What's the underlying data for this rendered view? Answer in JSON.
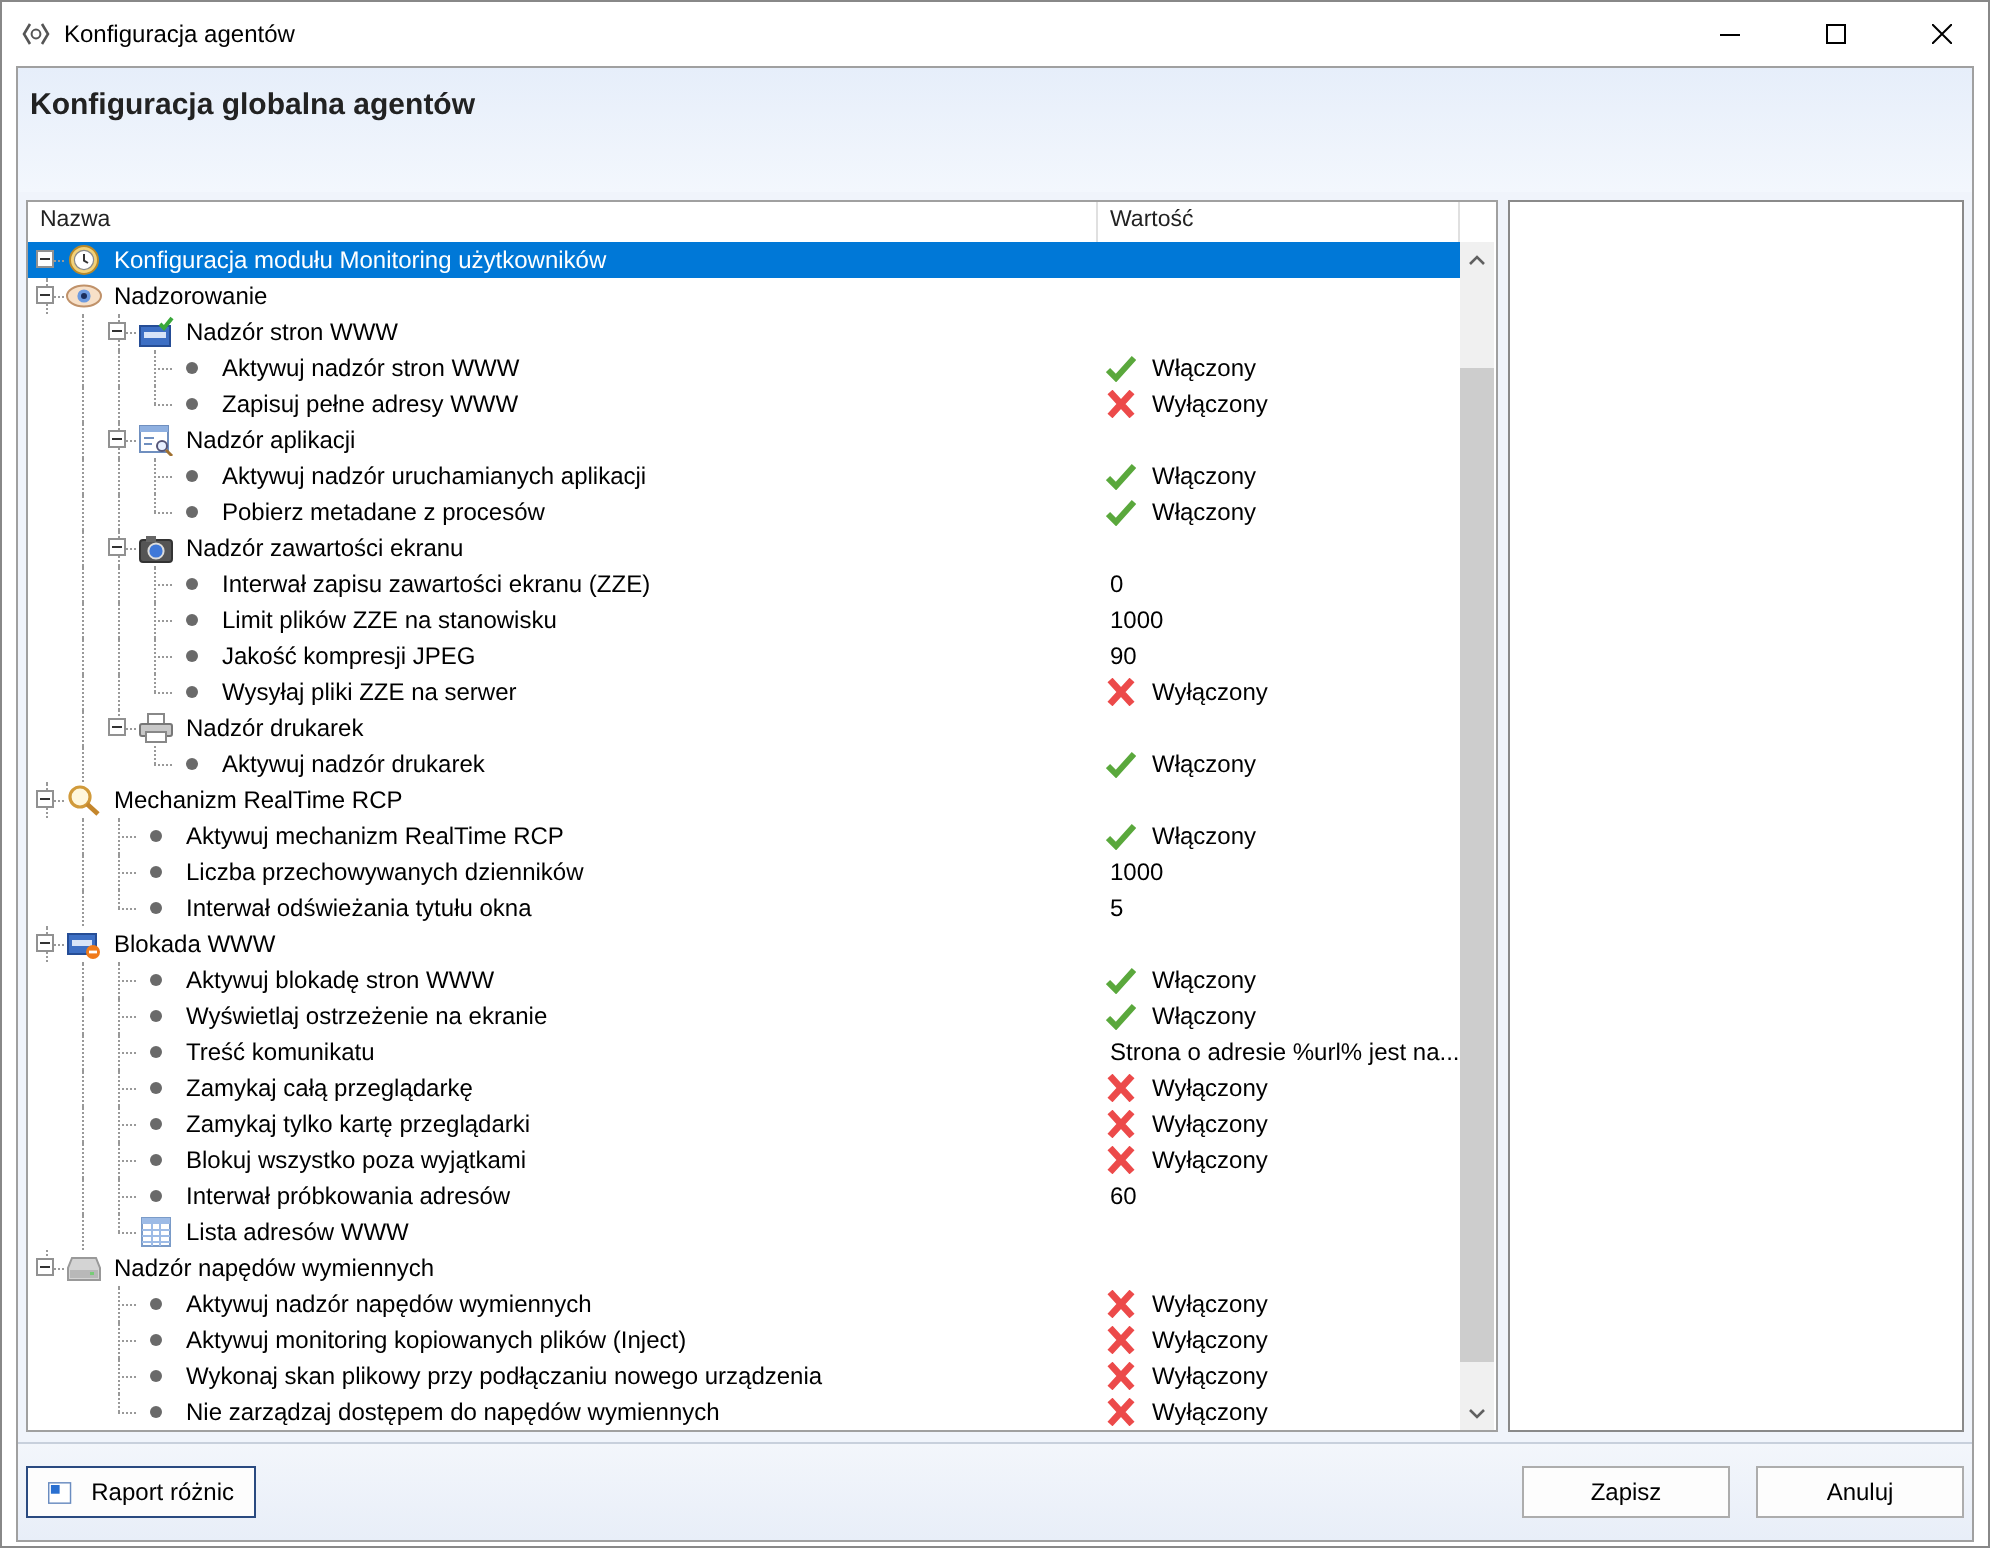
{
  "window": {
    "title": "Konfiguracja agentów"
  },
  "header": {
    "title": "Konfiguracja globalna agentów"
  },
  "tree": {
    "columns": [
      "Nazwa",
      "Wartość"
    ],
    "nodes": [
      {
        "label": "Konfiguracja modułu Monitoring użytkowników",
        "kind": "group",
        "expanded": true,
        "selected": true,
        "children": [
          {
            "label": "Nadzorowanie",
            "kind": "group",
            "expanded": true,
            "selected": false,
            "children": [
              {
                "label": "Nadzór stron WWW",
                "kind": "group",
                "expanded": true,
                "selected": false,
                "children": [
                  {
                    "label": "Aktywuj nadzór stron WWW",
                    "kind": "setting",
                    "selected": false,
                    "value": {
                      "kind": "toggle",
                      "on": true,
                      "text": "Włączony"
                    }
                  },
                  {
                    "label": "Zapisuj pełne adresy WWW",
                    "kind": "setting",
                    "selected": false,
                    "value": {
                      "kind": "toggle",
                      "on": false,
                      "text": "Wyłączony"
                    }
                  }
                ]
              },
              {
                "label": "Nadzór aplikacji",
                "kind": "group",
                "expanded": true,
                "selected": false,
                "children": [
                  {
                    "label": "Aktywuj nadzór uruchamianych aplikacji",
                    "kind": "setting",
                    "selected": false,
                    "value": {
                      "kind": "toggle",
                      "on": true,
                      "text": "Włączony"
                    }
                  },
                  {
                    "label": "Pobierz metadane z procesów",
                    "kind": "setting",
                    "selected": false,
                    "value": {
                      "kind": "toggle",
                      "on": true,
                      "text": "Włączony"
                    }
                  }
                ]
              },
              {
                "label": "Nadzór zawartości ekranu",
                "kind": "group",
                "expanded": true,
                "selected": false,
                "children": [
                  {
                    "label": "Interwał zapisu zawartości ekranu (ZZE)",
                    "kind": "setting",
                    "selected": false,
                    "value": {
                      "kind": "text",
                      "text": "0"
                    }
                  },
                  {
                    "label": "Limit plików ZZE na stanowisku",
                    "kind": "setting",
                    "selected": false,
                    "value": {
                      "kind": "text",
                      "text": "1000"
                    }
                  },
                  {
                    "label": "Jakość kompresji JPEG",
                    "kind": "setting",
                    "selected": false,
                    "value": {
                      "kind": "text",
                      "text": "90"
                    }
                  },
                  {
                    "label": "Wysyłaj pliki ZZE na serwer",
                    "kind": "setting",
                    "selected": false,
                    "value": {
                      "kind": "toggle",
                      "on": false,
                      "text": "Wyłączony"
                    }
                  }
                ]
              },
              {
                "label": "Nadzór drukarek",
                "kind": "group",
                "expanded": true,
                "selected": false,
                "children": [
                  {
                    "label": "Aktywuj nadzór drukarek",
                    "kind": "setting",
                    "selected": false,
                    "value": {
                      "kind": "toggle",
                      "on": true,
                      "text": "Włączony"
                    }
                  }
                ]
              }
            ]
          },
          {
            "label": "Mechanizm RealTime RCP",
            "kind": "group",
            "expanded": true,
            "selected": false,
            "children": [
              {
                "label": "Aktywuj mechanizm RealTime RCP",
                "kind": "setting",
                "selected": false,
                "value": {
                  "kind": "toggle",
                  "on": true,
                  "text": "Włączony"
                }
              },
              {
                "label": "Liczba przechowywanych dzienników",
                "kind": "setting",
                "selected": false,
                "value": {
                  "kind": "text",
                  "text": "1000"
                }
              },
              {
                "label": "Interwał odświeżania tytułu okna",
                "kind": "setting",
                "selected": false,
                "value": {
                  "kind": "text",
                  "text": "5"
                }
              }
            ]
          },
          {
            "label": "Blokada WWW",
            "kind": "group",
            "expanded": true,
            "selected": false,
            "children": [
              {
                "label": "Aktywuj blokadę stron WWW",
                "kind": "setting",
                "selected": false,
                "value": {
                  "kind": "toggle",
                  "on": true,
                  "text": "Włączony"
                }
              },
              {
                "label": "Wyświetlaj ostrzeżenie na ekranie",
                "kind": "setting",
                "selected": false,
                "value": {
                  "kind": "toggle",
                  "on": true,
                  "text": "Włączony"
                }
              },
              {
                "label": "Treść komunikatu",
                "kind": "setting",
                "selected": false,
                "value": {
                  "kind": "text",
                  "text": "Strona o adresie %url% jest na..."
                }
              },
              {
                "label": "Zamykaj całą przeglądarkę",
                "kind": "setting",
                "selected": false,
                "value": {
                  "kind": "toggle",
                  "on": false,
                  "text": "Wyłączony"
                }
              },
              {
                "label": "Zamykaj tylko kartę przeglądarki",
                "kind": "setting",
                "selected": false,
                "value": {
                  "kind": "toggle",
                  "on": false,
                  "text": "Wyłączony"
                }
              },
              {
                "label": "Blokuj wszystko poza wyjątkami",
                "kind": "setting",
                "selected": false,
                "value": {
                  "kind": "toggle",
                  "on": false,
                  "text": "Wyłączony"
                }
              },
              {
                "label": "Interwał próbkowania adresów",
                "kind": "setting",
                "selected": false,
                "value": {
                  "kind": "text",
                  "text": "60"
                }
              },
              {
                "label": "Lista adresów WWW",
                "kind": "list",
                "selected": false
              }
            ]
          },
          {
            "label": "Nadzór napędów wymiennych",
            "kind": "group",
            "expanded": true,
            "selected": false,
            "children": [
              {
                "label": "Aktywuj nadzór napędów wymiennych",
                "kind": "setting",
                "selected": false,
                "value": {
                  "kind": "toggle",
                  "on": false,
                  "text": "Wyłączony"
                }
              },
              {
                "label": "Aktywuj monitoring kopiowanych plików (Inject)",
                "kind": "setting",
                "selected": false,
                "value": {
                  "kind": "toggle",
                  "on": false,
                  "text": "Wyłączony"
                }
              },
              {
                "label": "Wykonaj skan plikowy przy podłączaniu nowego urządzenia",
                "kind": "setting",
                "selected": false,
                "value": {
                  "kind": "toggle",
                  "on": false,
                  "text": "Wyłączony"
                }
              },
              {
                "label": "Nie zarządzaj dostępem do napędów wymiennych",
                "kind": "setting",
                "selected": false,
                "value": {
                  "kind": "toggle",
                  "on": false,
                  "text": "Wyłączony"
                }
              }
            ]
          }
        ]
      }
    ]
  },
  "buttons": {
    "left": [
      {
        "label": "Raport różnic"
      }
    ],
    "right": [
      {
        "label": "Zapisz"
      },
      {
        "label": "Anuluj"
      }
    ]
  }
}
